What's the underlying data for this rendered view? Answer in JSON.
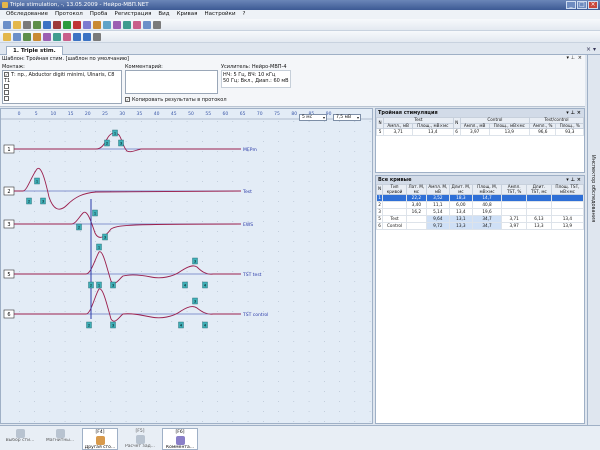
{
  "window": {
    "title": "Triple stimulation, -, 13.05.2009 - Нейро-МВП.NET"
  },
  "menu": [
    "Обследование",
    "Протокол",
    "Проба",
    "Регистрация",
    "Вид",
    "Кривая",
    "Настройки",
    "?"
  ],
  "tab": {
    "label": "1. Triple stim."
  },
  "info": {
    "template": "Шаблон: Тройная стим. [шаблон по умолчанию]",
    "montage_label": "Монтаж:",
    "montage_value": "Т: пр., Abductor digiti minimi, Ulnaris, C8 T1",
    "comment_label": "Комментарий:",
    "amplifier_label": "Усилитель: Нейро-МВП-4",
    "amp_line1": "НЧ: 5 Гц, ВЧ: 10 кГц",
    "amp_line2": "50 Гц: Вкл., Диап.: 60 мВ",
    "copy_label": "Копировать результаты в протокол"
  },
  "chart": {
    "sweep_select": "5 мс",
    "sens_select": "7,5 мВ",
    "x_ticks": [
      "0",
      "5",
      "10",
      "15",
      "20",
      "25",
      "30",
      "35",
      "40",
      "45",
      "50",
      "55",
      "60",
      "65",
      "70",
      "75",
      "80",
      "85",
      "90"
    ],
    "trace_labels": [
      "MEPm",
      "Test",
      "EWS",
      "TST test",
      "TST control"
    ],
    "row_numbers": [
      "1",
      "2",
      "3",
      "5",
      "6"
    ],
    "markers": [
      "1",
      "2",
      "3",
      "4"
    ]
  },
  "triple_panel": {
    "title": "Тройная стимуляция",
    "group_headers": [
      "N",
      "Test",
      "Control",
      "Test/control"
    ],
    "sub_headers": [
      "Ампл., мВ",
      "Площ., мВ×мс",
      "Ампл., мВ",
      "Площ., мВ×мс",
      "Ампл., %",
      "Площ., %"
    ],
    "rows": [
      [
        "5",
        "3,71",
        "13,4",
        "6",
        "3,97",
        "13,9",
        "96,6",
        "93,3"
      ]
    ]
  },
  "curves_panel": {
    "title": "Все кривые",
    "headers": [
      "N",
      "Тип кривой",
      "Лат. М, мс",
      "Ампл. М, мВ",
      "Длит. М, мс",
      "Площ. М, мВ×мс",
      "Ампл. TST, %",
      "Длит. TST, мс",
      "Площ. TST, мВ×мс"
    ],
    "rows": [
      [
        "1",
        "",
        "22,2",
        "3,52",
        "18,3",
        "14,7",
        "",
        "",
        ""
      ],
      [
        "2",
        "",
        "3,40",
        "11,1",
        "6,00",
        "40,8",
        "",
        "",
        ""
      ],
      [
        "3",
        "",
        "16,2",
        "5,14",
        "13,4",
        "19,6",
        "",
        "",
        ""
      ],
      [
        "5",
        "Test",
        "",
        "9,64",
        "13,1",
        "34,7",
        "3,71",
        "6,13",
        "13,4"
      ],
      [
        "6",
        "Control",
        "",
        "9,72",
        "13,3",
        "34,7",
        "3,97",
        "13,3",
        "13,9"
      ]
    ]
  },
  "side_tab": "Инспектор обследования",
  "bottom": [
    {
      "key": "",
      "label": "Выбор сти..."
    },
    {
      "key": "",
      "label": "Магнитны..."
    },
    {
      "key": "[F4]",
      "label": "Другая сто..."
    },
    {
      "key": "[F5]",
      "label": "Расчет зад..."
    },
    {
      "key": "[F6]",
      "label": "Коммента..."
    }
  ],
  "colors": {
    "curve": "#9b1f4d",
    "baseline": "#2a3aa8",
    "marker": "#3fb0b8"
  }
}
